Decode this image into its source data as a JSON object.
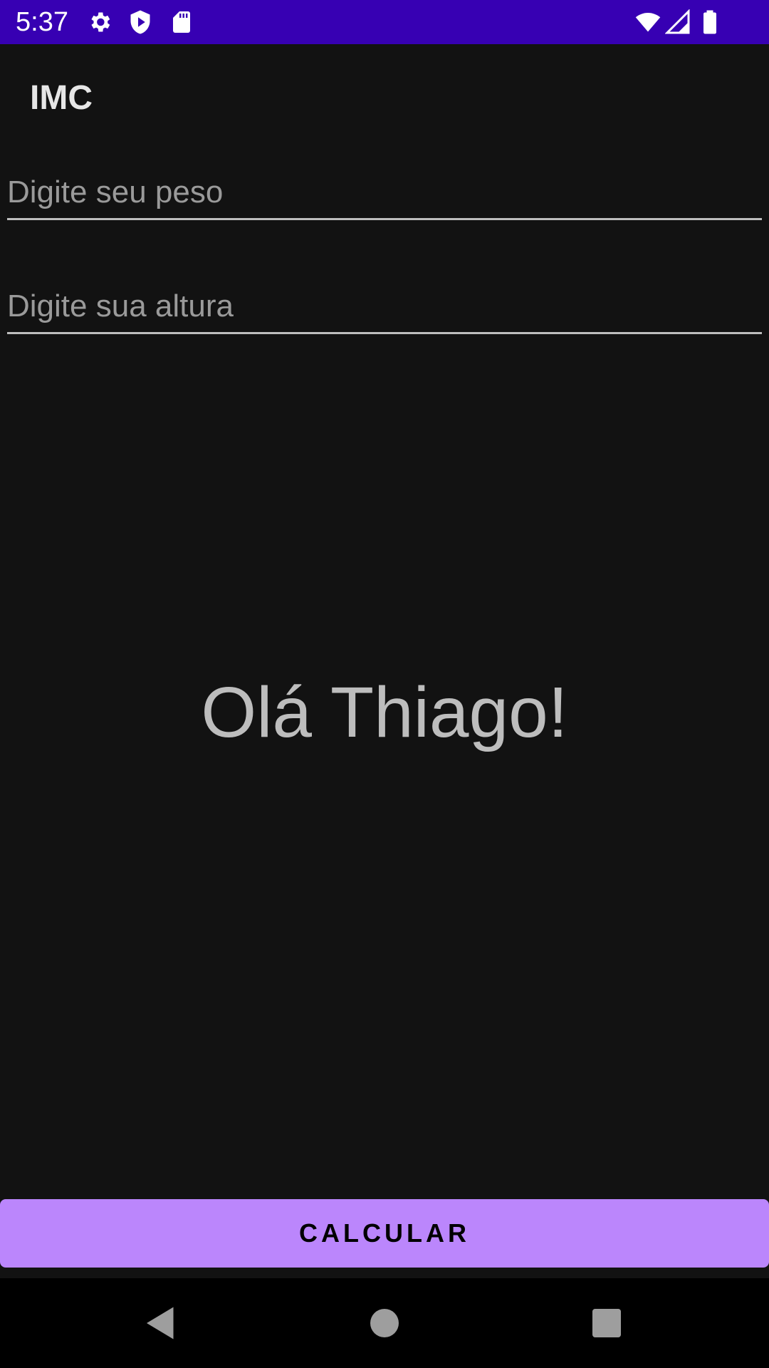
{
  "status_bar": {
    "time": "5:37",
    "icons": [
      "gear-icon",
      "shield-play-icon",
      "sd-card-icon",
      "wifi-icon",
      "signal-icon",
      "battery-icon"
    ],
    "background": "#3700b3"
  },
  "app_bar": {
    "title": "IMC"
  },
  "form": {
    "weight_placeholder": "Digite seu peso",
    "weight_value": "",
    "height_placeholder": "Digite sua altura",
    "height_value": ""
  },
  "greeting": "Olá Thiago!",
  "calculate_button": {
    "label": "CALCULAR",
    "color": "#bb86fc"
  },
  "nav_bar": {
    "buttons": [
      "back-icon",
      "home-icon",
      "recents-icon"
    ]
  }
}
